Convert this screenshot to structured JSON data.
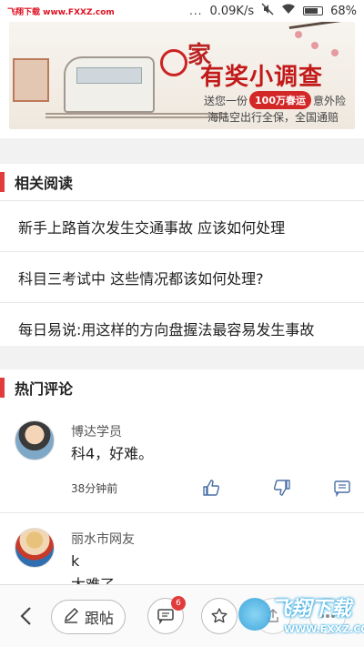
{
  "status_bar": {
    "watermark": "飞翔下载 www.FXXZ.com",
    "dots": "...",
    "speed": "0.09K/s",
    "battery": "68%"
  },
  "banner": {
    "brand_char": "家",
    "headline": "有奖小调查",
    "line1_prefix": "送您一份",
    "line1_highlight": "100万春运",
    "line1_suffix": "意外险",
    "line2": "海陆空出行全保，全国通赔"
  },
  "related": {
    "title": "相关阅读",
    "items": [
      {
        "text": "新手上路首次发生交通事故 应该如何处理"
      },
      {
        "text": "科目三考试中 这些情况都该如何处理?"
      },
      {
        "text": "每日易说:用这样的方向盘握法最容易发生事故"
      }
    ]
  },
  "hot_comments": {
    "title": "热门评论",
    "items": [
      {
        "user": "博达学员",
        "text": "科4，好难。",
        "time": "38分钟前"
      },
      {
        "user": "丽水市网友",
        "text": "k\n太难了",
        "time": ""
      }
    ]
  },
  "bottom_bar": {
    "reply_label": "跟帖",
    "comment_badge": "6"
  },
  "watermark_br": {
    "big": "飞翔下载",
    "small": "WWW.FXXZ.COM"
  },
  "colors": {
    "accent": "#e23b3b",
    "icon_blue": "#4a6fa5"
  }
}
